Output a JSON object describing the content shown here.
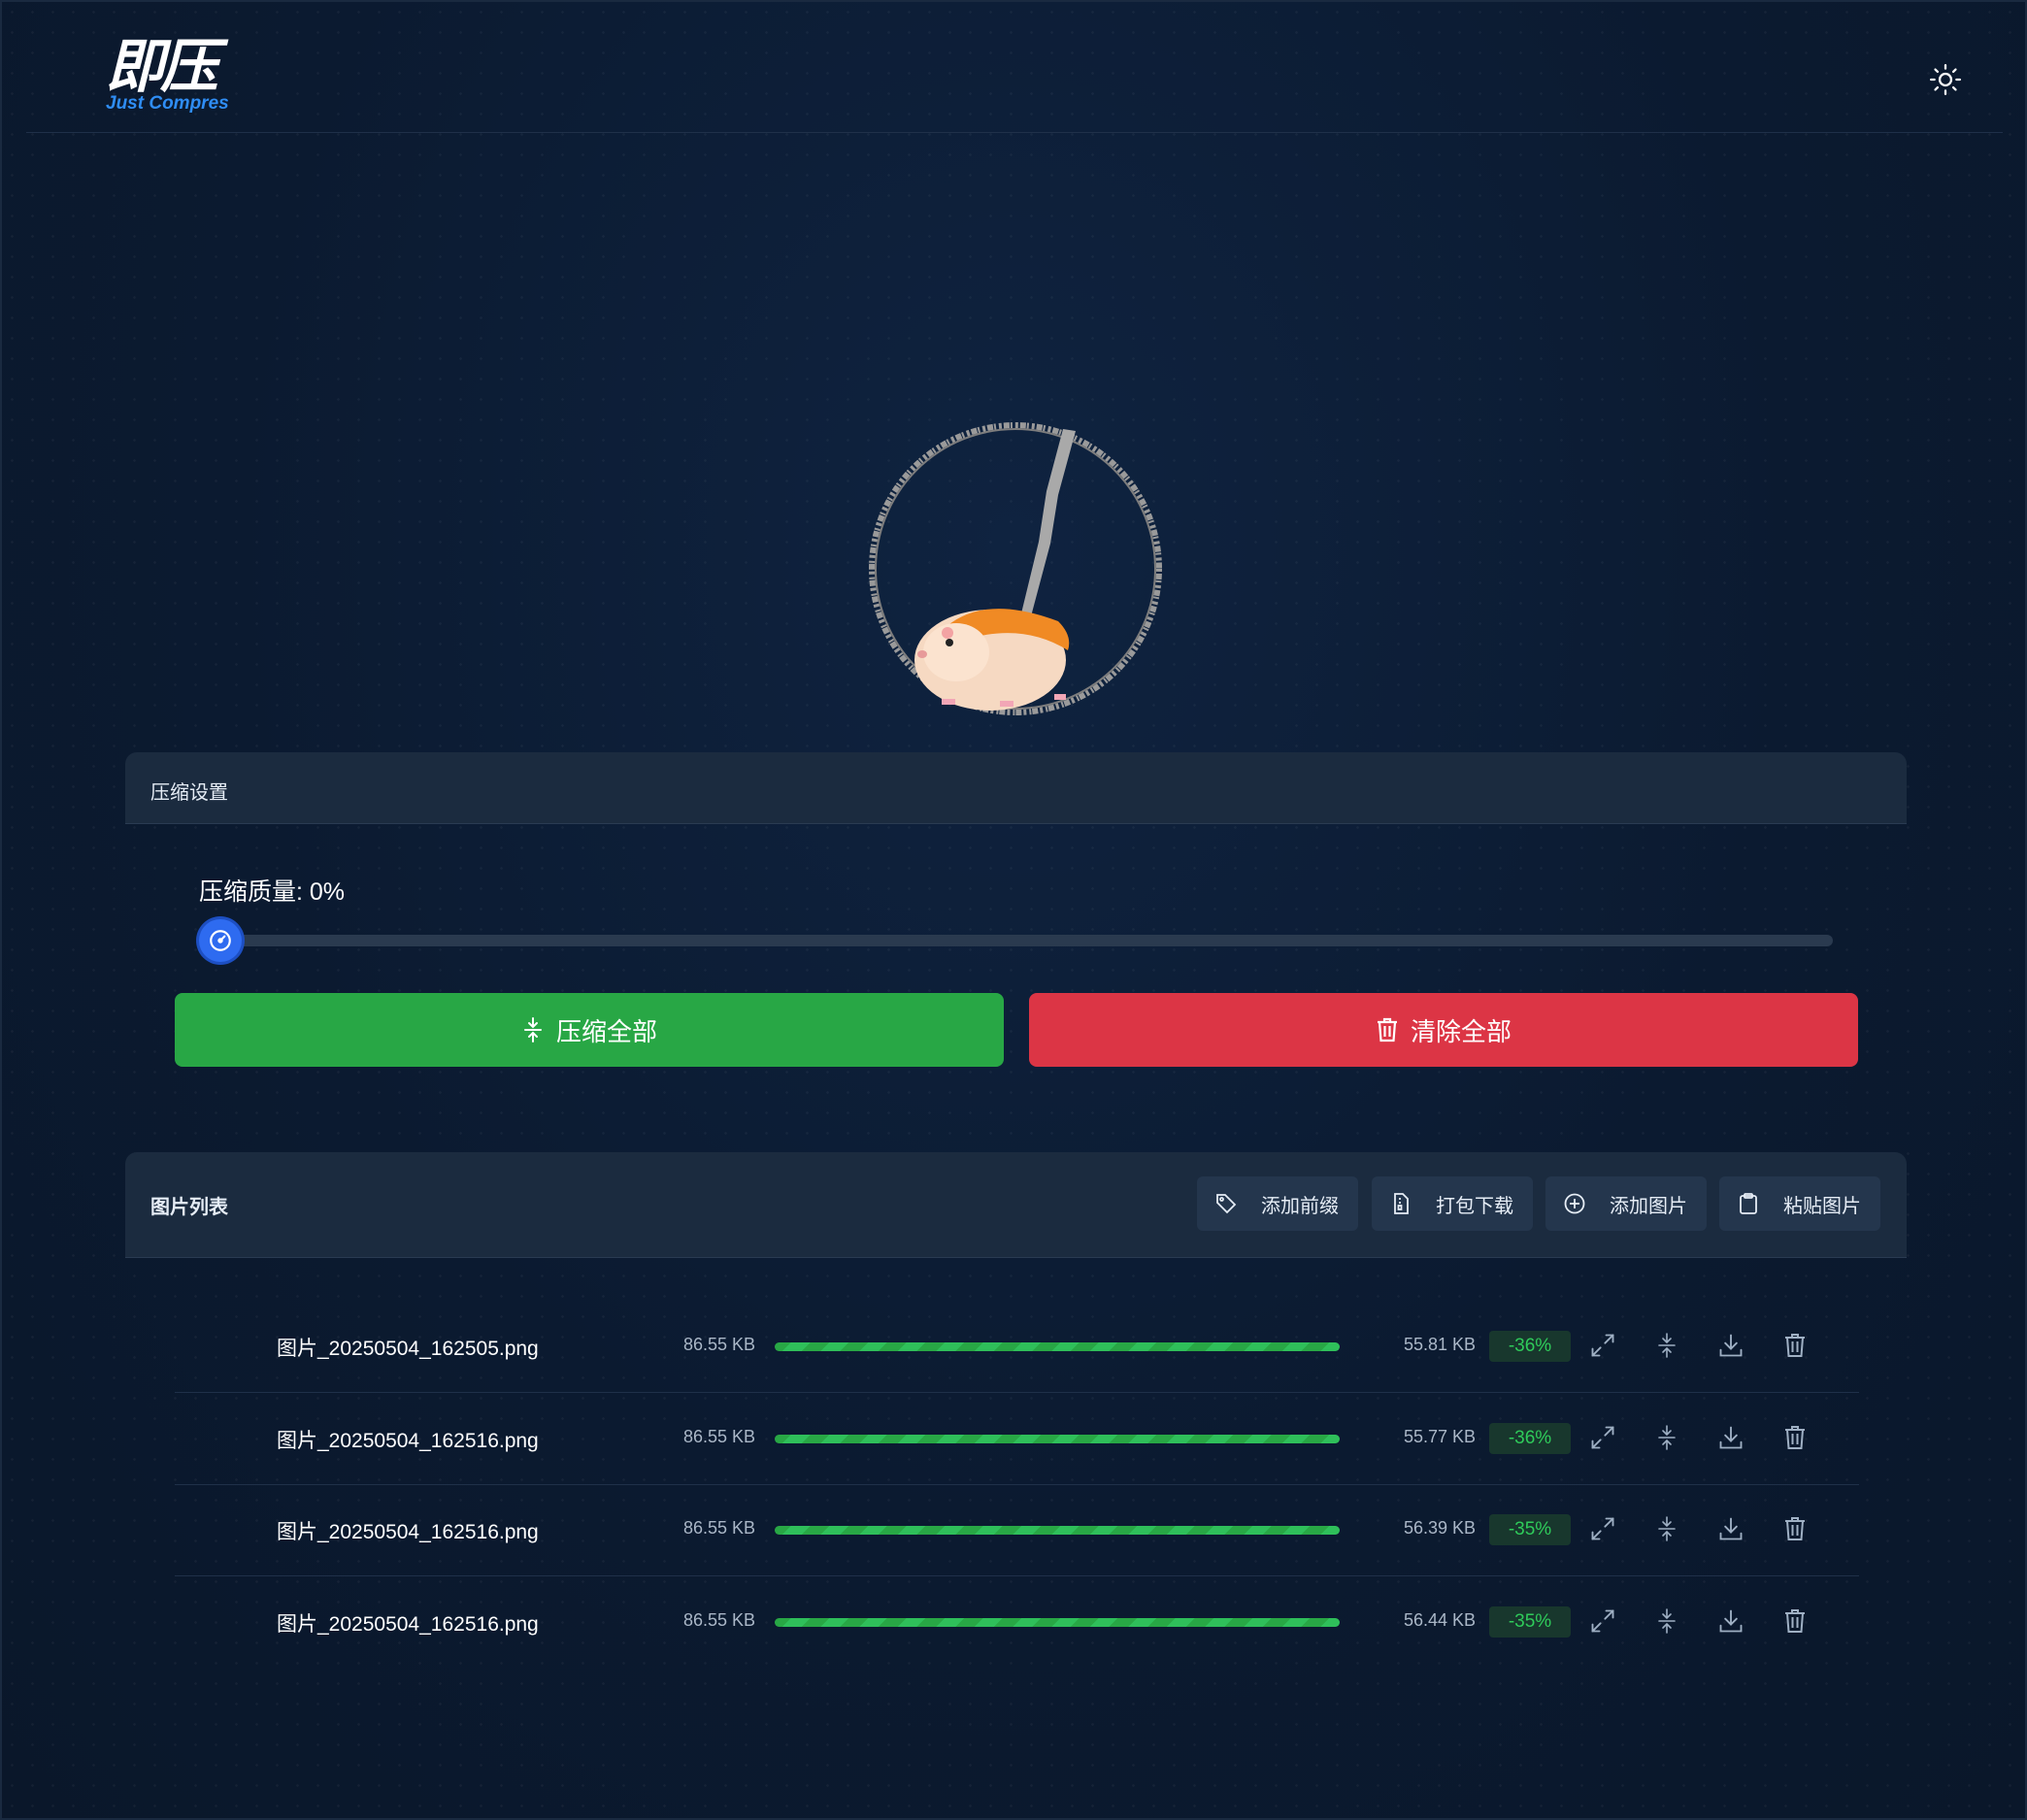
{
  "header": {
    "logo_cn": "即压",
    "logo_en": "Just Compres",
    "theme_toggle_icon": "sun-icon"
  },
  "settings": {
    "title": "压缩设置",
    "quality_label": "压缩质量: 0%",
    "quality_value": 0,
    "compress_all": "压缩全部",
    "clear_all": "清除全部"
  },
  "list": {
    "title": "图片列表",
    "tools": [
      {
        "label": "添加前缀",
        "icon": "tag-icon"
      },
      {
        "label": "打包下载",
        "icon": "zip-file-icon"
      },
      {
        "label": "添加图片",
        "icon": "plus-circle-icon"
      },
      {
        "label": "粘贴图片",
        "icon": "clipboard-icon"
      }
    ],
    "rows": [
      {
        "name": "图片_20250504_162505.png",
        "original": "86.55 KB",
        "progress": 1.0,
        "compressed": "55.81 KB",
        "percent": "-36%"
      },
      {
        "name": "图片_20250504_162516.png",
        "original": "86.55 KB",
        "progress": 1.0,
        "compressed": "55.77 KB",
        "percent": "-36%"
      },
      {
        "name": "图片_20250504_162516.png",
        "original": "86.55 KB",
        "progress": 1.0,
        "compressed": "56.39 KB",
        "percent": "-35%"
      },
      {
        "name": "图片_20250504_162516.png",
        "original": "86.55 KB",
        "progress": 1.0,
        "compressed": "56.44 KB",
        "percent": "-35%"
      }
    ]
  },
  "colors": {
    "accent_green": "#28a745",
    "accent_red": "#dc3545",
    "brand_blue": "#2f8df4"
  }
}
